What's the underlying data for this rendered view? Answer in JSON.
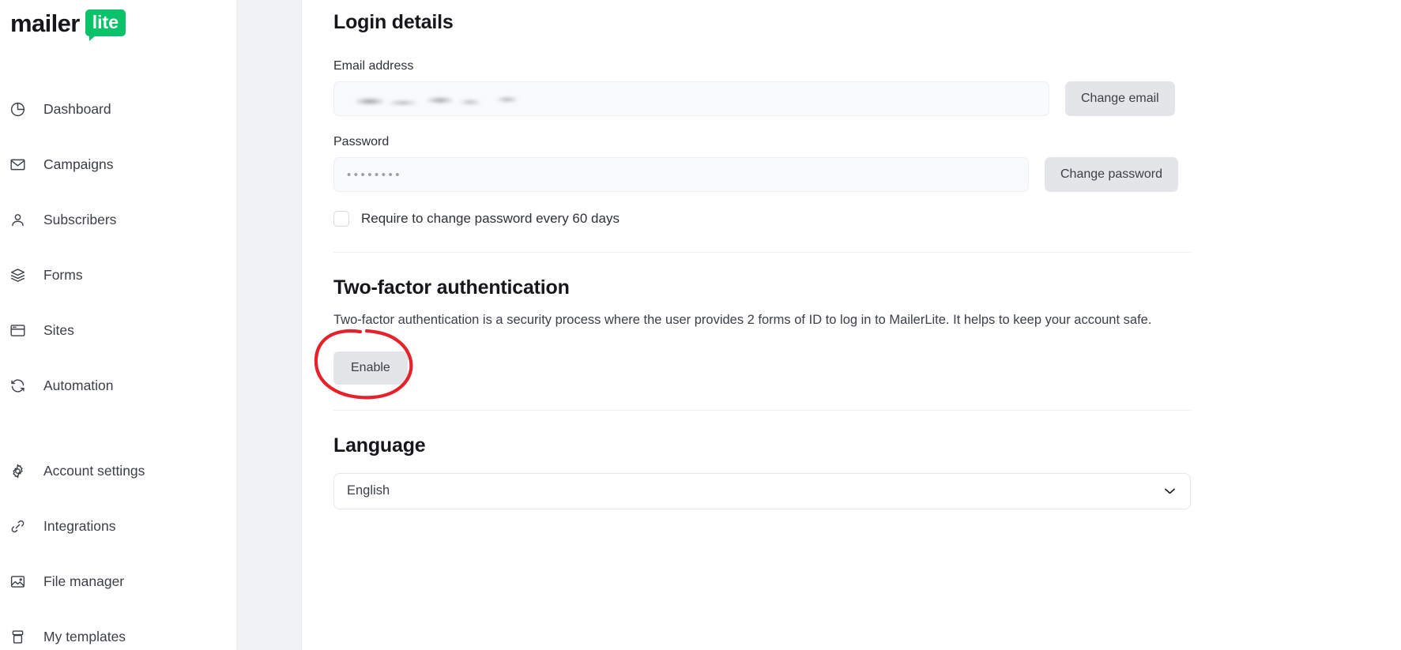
{
  "brand": {
    "name": "mailer",
    "badge": "lite",
    "badge_color": "#09c269"
  },
  "sidebar": {
    "items": [
      {
        "label": "Dashboard",
        "icon": "pie-chart-icon"
      },
      {
        "label": "Campaigns",
        "icon": "envelope-icon"
      },
      {
        "label": "Subscribers",
        "icon": "user-icon"
      },
      {
        "label": "Forms",
        "icon": "layers-icon"
      },
      {
        "label": "Sites",
        "icon": "browser-window-icon"
      },
      {
        "label": "Automation",
        "icon": "refresh-icon"
      },
      {
        "label": "Account settings",
        "icon": "gear-icon"
      },
      {
        "label": "Integrations",
        "icon": "link-icon"
      },
      {
        "label": "File manager",
        "icon": "image-icon"
      },
      {
        "label": "My templates",
        "icon": "template-icon"
      }
    ]
  },
  "scrollbar": {
    "thumb_color": "#c2c2c4",
    "track_color": "#f1f1f2",
    "arrow_icon": "chevron-down-icon"
  },
  "login_details": {
    "title": "Login details",
    "email": {
      "label": "Email address",
      "value": "",
      "value_redacted": true,
      "button": "Change email"
    },
    "password": {
      "label": "Password",
      "value": "••••••••",
      "button": "Change password"
    },
    "require_change": {
      "label": "Require to change password every 60 days",
      "checked": false
    }
  },
  "two_factor": {
    "title": "Two-factor authentication",
    "description": "Two-factor authentication is a security process where the user provides 2 forms of ID to log in to MailerLite. It helps to keep your account safe.",
    "button": "Enable",
    "annotation": {
      "type": "hand-drawn-circle",
      "color": "#e8202a",
      "target": "Enable"
    }
  },
  "language": {
    "title": "Language",
    "selected": "English",
    "options": [
      "English"
    ],
    "chevron_icon": "chevron-down-icon"
  }
}
